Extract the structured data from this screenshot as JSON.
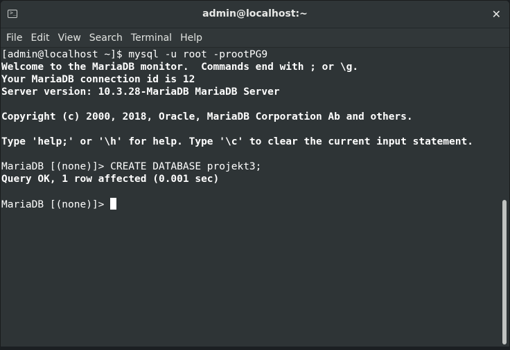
{
  "window": {
    "title": "admin@localhost:~",
    "close_glyph": "✕"
  },
  "menu": {
    "items": [
      "File",
      "Edit",
      "View",
      "Search",
      "Terminal",
      "Help"
    ]
  },
  "terminal": {
    "lines": [
      {
        "text": "[admin@localhost ~]$ mysql -u root -prootPG9",
        "bold": false
      },
      {
        "text": "Welcome to the MariaDB monitor.  Commands end with ; or \\g.",
        "bold": true
      },
      {
        "text": "Your MariaDB connection id is 12",
        "bold": true
      },
      {
        "text": "Server version: 10.3.28-MariaDB MariaDB Server",
        "bold": true
      },
      {
        "text": "",
        "bold": false
      },
      {
        "text": "Copyright (c) 2000, 2018, Oracle, MariaDB Corporation Ab and others.",
        "bold": true
      },
      {
        "text": "",
        "bold": false
      },
      {
        "text": "Type 'help;' or '\\h' for help. Type '\\c' to clear the current input statement.",
        "bold": true
      },
      {
        "text": "",
        "bold": false
      },
      {
        "text": "MariaDB [(none)]> CREATE DATABASE projekt3;",
        "bold": false
      },
      {
        "text": "Query OK, 1 row affected (0.001 sec)",
        "bold": true
      },
      {
        "text": "",
        "bold": false
      },
      {
        "text": "MariaDB [(none)]> ",
        "bold": false,
        "cursor": true
      }
    ]
  },
  "colors": {
    "background": "#2e3436",
    "foreground": "#ffffff",
    "scroll_thumb": "#bfc2c0"
  },
  "icons": {
    "title": "terminal-icon",
    "close": "close-icon",
    "cursor": "text-cursor"
  }
}
